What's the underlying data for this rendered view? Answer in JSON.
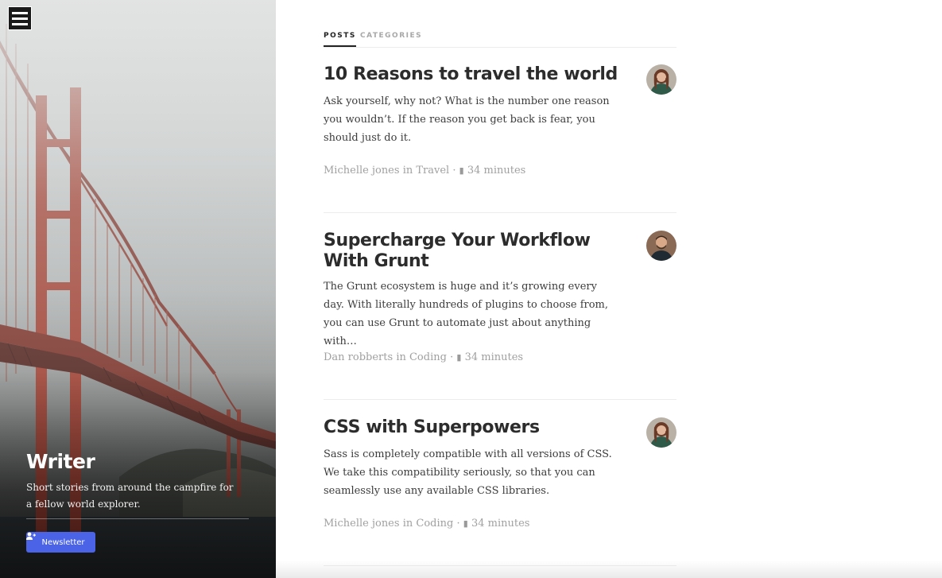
{
  "site": {
    "title": "Writer",
    "description": "Short stories from around the campfire for a fellow world explorer.",
    "newsletter_label": "Newsletter",
    "menu_icon": "hamburger-menu-icon",
    "newsletter_icon": "user-plus-icon"
  },
  "tabs": [
    {
      "label": "POSTS",
      "active": true
    },
    {
      "label": "CATEGORIES",
      "active": false
    }
  ],
  "posts": [
    {
      "title": "10 Reasons to travel the world",
      "excerpt": "Ask yourself, why not? What is the number one reason you wouldn’t. If the reason you get back is fear, you should just do it.",
      "author": "Michelle jones",
      "in_word": "in",
      "category": "Travel",
      "separator": "·",
      "read_time": "34 minutes",
      "avatar": "woman-avatar"
    },
    {
      "title": "Supercharge Your Workflow With Grunt",
      "excerpt": "The Grunt ecosystem is huge and it’s growing every day. With literally hundreds of plugins to choose from, you can use Grunt to automate just about anything with…",
      "author": "Dan robberts",
      "in_word": "in",
      "category": "Coding",
      "separator": "·",
      "read_time": "34 minutes",
      "avatar": "man-avatar"
    },
    {
      "title": "CSS with Superpowers",
      "excerpt": "Sass is completely compatible with all versions of CSS. We take this compatibility seriously, so that you can seamlessly use any available CSS libraries.",
      "author": "Michelle jones",
      "in_word": "in",
      "category": "Coding",
      "separator": "·",
      "read_time": "34 minutes",
      "avatar": "woman-avatar"
    }
  ],
  "colors": {
    "accent": "#4a63e7",
    "text": "#2c2c2c",
    "meta": "#a0a0a0",
    "bridge": "#a33b2c"
  }
}
